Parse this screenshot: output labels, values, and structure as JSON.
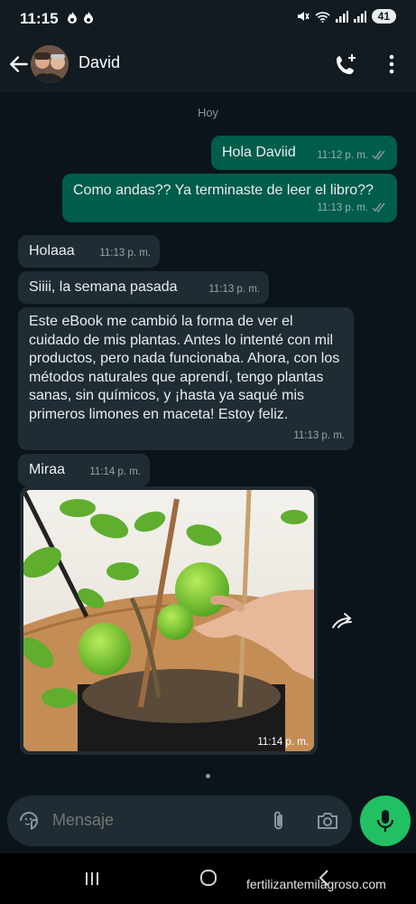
{
  "status_bar": {
    "time": "11:15",
    "battery": "41"
  },
  "header": {
    "contact_name": "David"
  },
  "day_label": "Hoy",
  "messages": [
    {
      "dir": "out",
      "text": "Hola Daviid",
      "time": "11:12 p. m."
    },
    {
      "dir": "out",
      "text": "Como andas?? Ya terminaste de leer el libro??",
      "time": "11:13 p. m."
    },
    {
      "dir": "in",
      "text": "Holaaa",
      "time": "11:13 p. m."
    },
    {
      "dir": "in",
      "text": "Siiii, la semana pasada",
      "time": "11:13 p. m."
    },
    {
      "dir": "in",
      "text": "Este eBook me cambió la forma de ver el cuidado de mis plantas. Antes lo intenté con mil productos, pero nada funcionaba. Ahora, con los métodos naturales que aprendí, tengo plantas sanas, sin químicos, y ¡hasta ya saqué mis primeros limones en maceta! Estoy feliz.",
      "time": "11:13 p. m."
    },
    {
      "dir": "in",
      "text": "Miraa",
      "time": "11:14 p. m."
    },
    {
      "dir": "in",
      "type": "image",
      "time": "11:14 p. m."
    }
  ],
  "composer": {
    "placeholder": "Mensaje"
  },
  "colors": {
    "outgoing": "#005c4b",
    "incoming": "#202c33",
    "background": "#0b141a",
    "mic": "#21c063",
    "read_ticks": "#8696a0"
  },
  "icons": [
    "back-arrow-icon",
    "add-call-icon",
    "more-options-icon",
    "sticker-icon",
    "attach-clip-icon",
    "camera-icon",
    "mic-icon",
    "forward-icon"
  ],
  "watermark": "fertilizantemilagroso.com"
}
